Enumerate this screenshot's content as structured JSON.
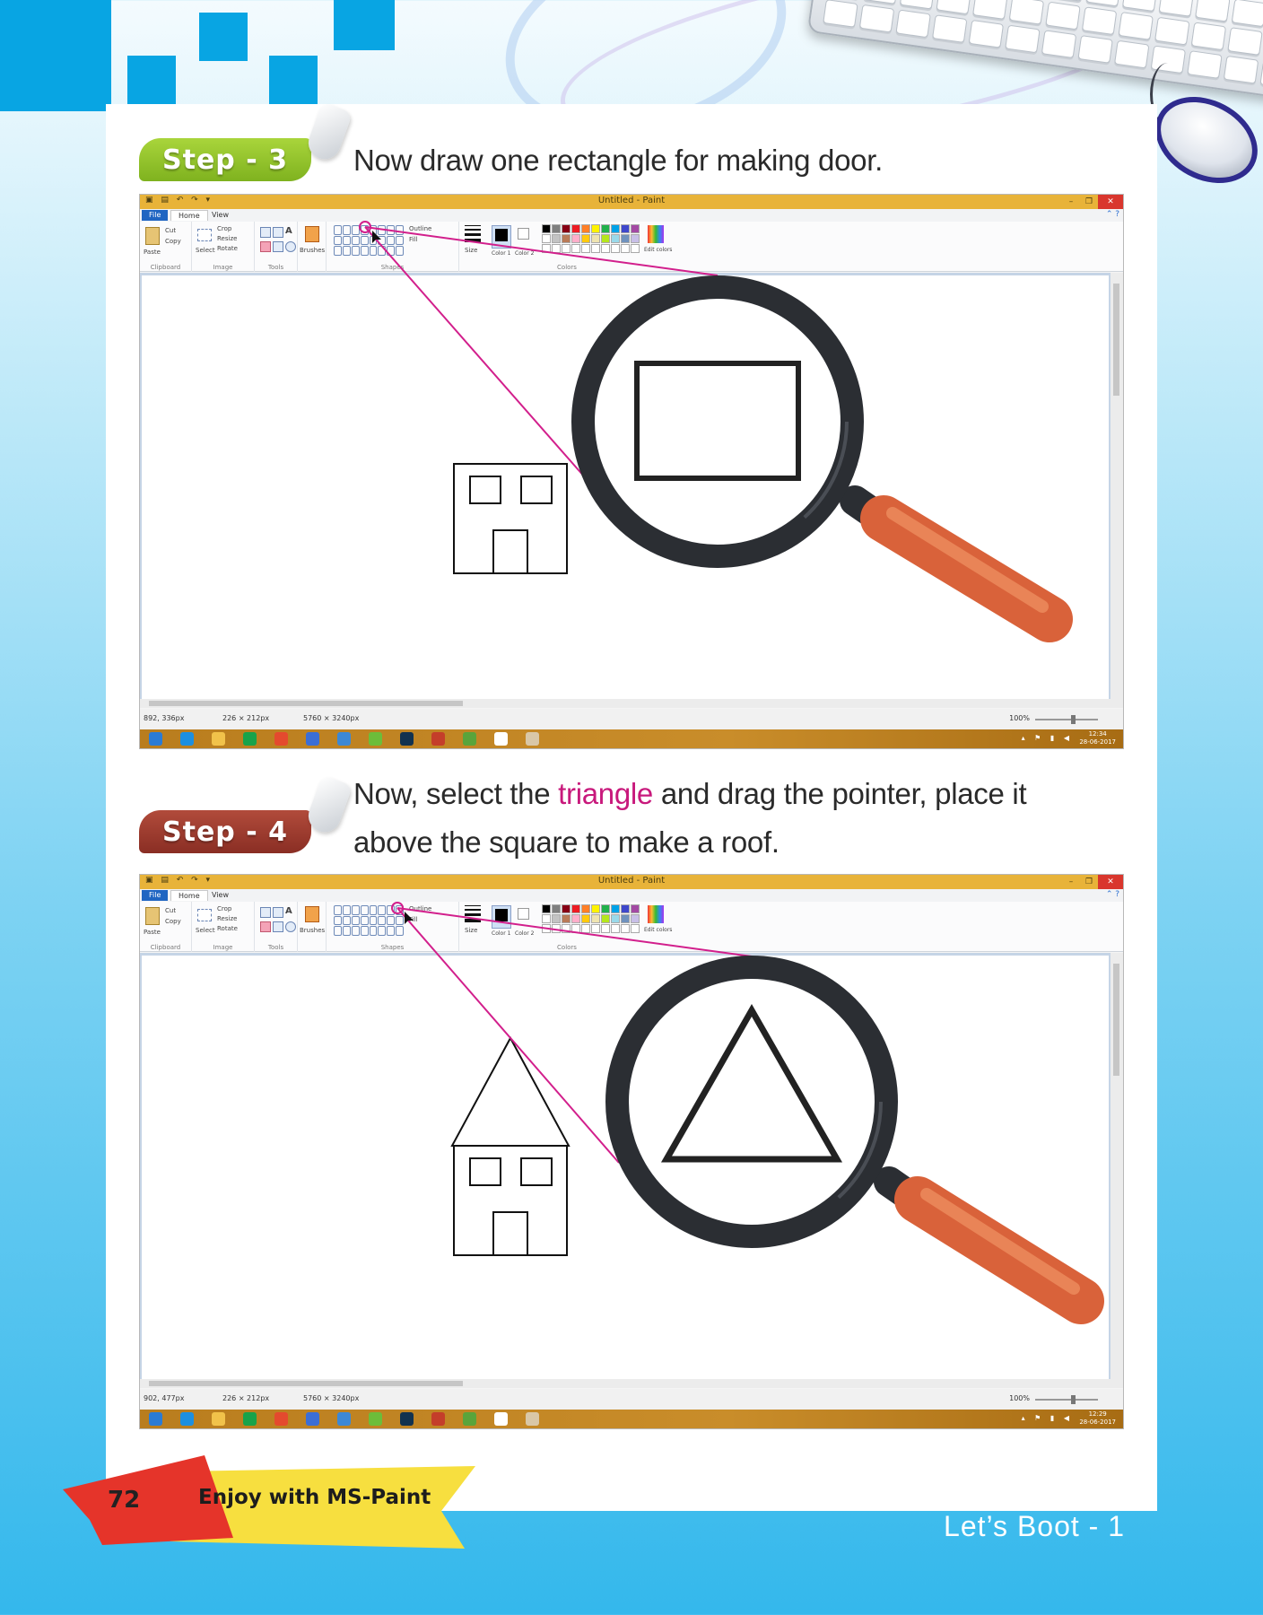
{
  "steps": [
    {
      "badge": "Step - 3",
      "heading_plain": "Now draw one rectangle for making door.",
      "zoom_shape": "rectangle",
      "status": {
        "cursor_pos": "892, 336px",
        "selection_size": "226 × 212px",
        "canvas_size": "5760 × 3240px",
        "zoom": "100%"
      },
      "clock": {
        "time": "12:34",
        "date": "28-06-2017"
      }
    },
    {
      "badge": "Step - 4",
      "heading_pre": "Now, select the ",
      "heading_highlight": "triangle",
      "heading_post_line1": " and drag the pointer, place it",
      "heading_line2": "above the square to make a roof.",
      "zoom_shape": "triangle",
      "status": {
        "cursor_pos": "902, 477px",
        "selection_size": "226 × 212px",
        "canvas_size": "5760 × 3240px",
        "zoom": "100%"
      },
      "clock": {
        "time": "12:29",
        "date": "28-06-2017"
      }
    }
  ],
  "paint": {
    "window_title": "Untitled - Paint",
    "tabs": [
      "File",
      "Home",
      "View"
    ],
    "groups": [
      "Clipboard",
      "Image",
      "Tools",
      "Shapes",
      "Colors"
    ],
    "clipboard": {
      "paste": "Paste",
      "cut": "Cut",
      "copy": "Copy"
    },
    "image": {
      "select": "Select",
      "crop": "Crop",
      "resize": "Resize",
      "rotate": "Rotate"
    },
    "brushes": "Brushes",
    "outline": "Outline",
    "fill": "Fill",
    "size": "Size",
    "color1": "Color 1",
    "color2": "Color 2",
    "edit_colors": "Edit colors",
    "palette": [
      "#000000",
      "#7f7f7f",
      "#880015",
      "#ed1c24",
      "#ff7f27",
      "#fff200",
      "#22b14c",
      "#00a2e8",
      "#3f48cc",
      "#a349a4",
      "#ffffff",
      "#c3c3c3",
      "#b97a57",
      "#ffaec9",
      "#ffc90e",
      "#efe4b0",
      "#b5e61d",
      "#99d9ea",
      "#7092be",
      "#c8bfe7"
    ]
  },
  "footer": {
    "page_number": "72",
    "chapter": "Enjoy with MS-Paint",
    "book": "Let’s Boot - 1"
  },
  "colors": {
    "accent_blue": "#08a5e3",
    "step3_badge": "#8fc42a",
    "step4_badge": "#9c3a2e",
    "highlight": "#c8197c",
    "magnifier_handle": "#d9623a",
    "pointer_line": "#d21f8c"
  }
}
